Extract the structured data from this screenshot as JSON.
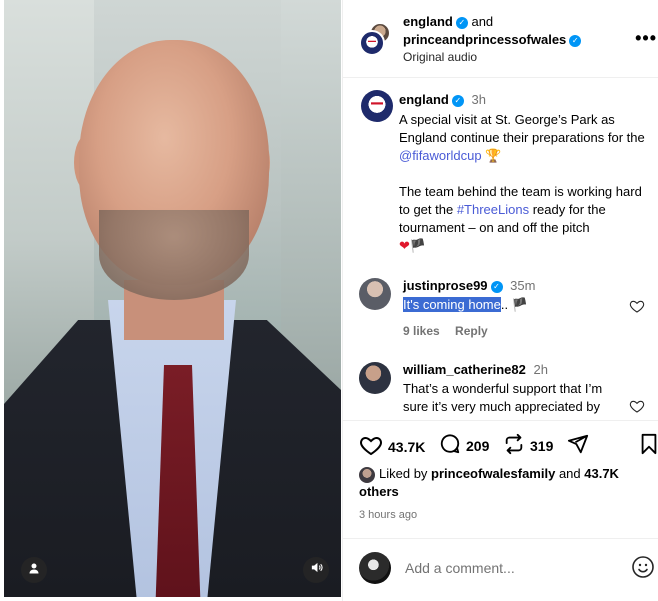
{
  "post": {
    "author": "england",
    "coauthor_joiner": "and",
    "coauthor": "princeandprincessofwales",
    "audio": "Original audio",
    "more_label": "•••"
  },
  "caption": {
    "user": "england",
    "time": "3h",
    "line1": "A special visit at St. George’s Park as England continue their preparations for the ",
    "mention": "@fifaworldcup",
    "trophy": "🏆",
    "line2a": "The team behind the team is working hard to get the ",
    "hashtag": "#ThreeLions",
    "line2b": " ready for the tournament – on and off the pitch",
    "emojis_heart": "❤",
    "emojis_flag": "🏴"
  },
  "comments": [
    {
      "user": "justinprose99",
      "time": "35m",
      "text_highlighted": "It's coming home",
      "text_rest": ".. 🏴",
      "likes": "9 likes",
      "reply": "Reply"
    },
    {
      "user": "william_catherine82",
      "time": "2h",
      "text": "That’s a wonderful support that I’m sure it’s very much appreciated by"
    }
  ],
  "stats": {
    "likes": "43.7K",
    "comments": "209",
    "reposts": "319"
  },
  "liked_by": {
    "prefix": "Liked by ",
    "user": "princeofwalesfamily",
    "middle": " and ",
    "count": "43.7K",
    "suffix": "others"
  },
  "posted_ago": "3 hours ago",
  "add_comment": {
    "placeholder": "Add a comment..."
  },
  "icons": {
    "verified": "verified-badge-icon",
    "like": "heart-icon",
    "comment": "comment-bubble-icon",
    "repost": "repost-icon",
    "share": "paper-plane-icon",
    "save": "bookmark-icon",
    "emoji": "emoji-icon",
    "user": "user-icon",
    "sound": "volume-icon"
  },
  "colors": {
    "verified": "#0095f6",
    "link": "#4a5bd6",
    "muted": "#737373",
    "highlight": "#3b6bd3"
  }
}
